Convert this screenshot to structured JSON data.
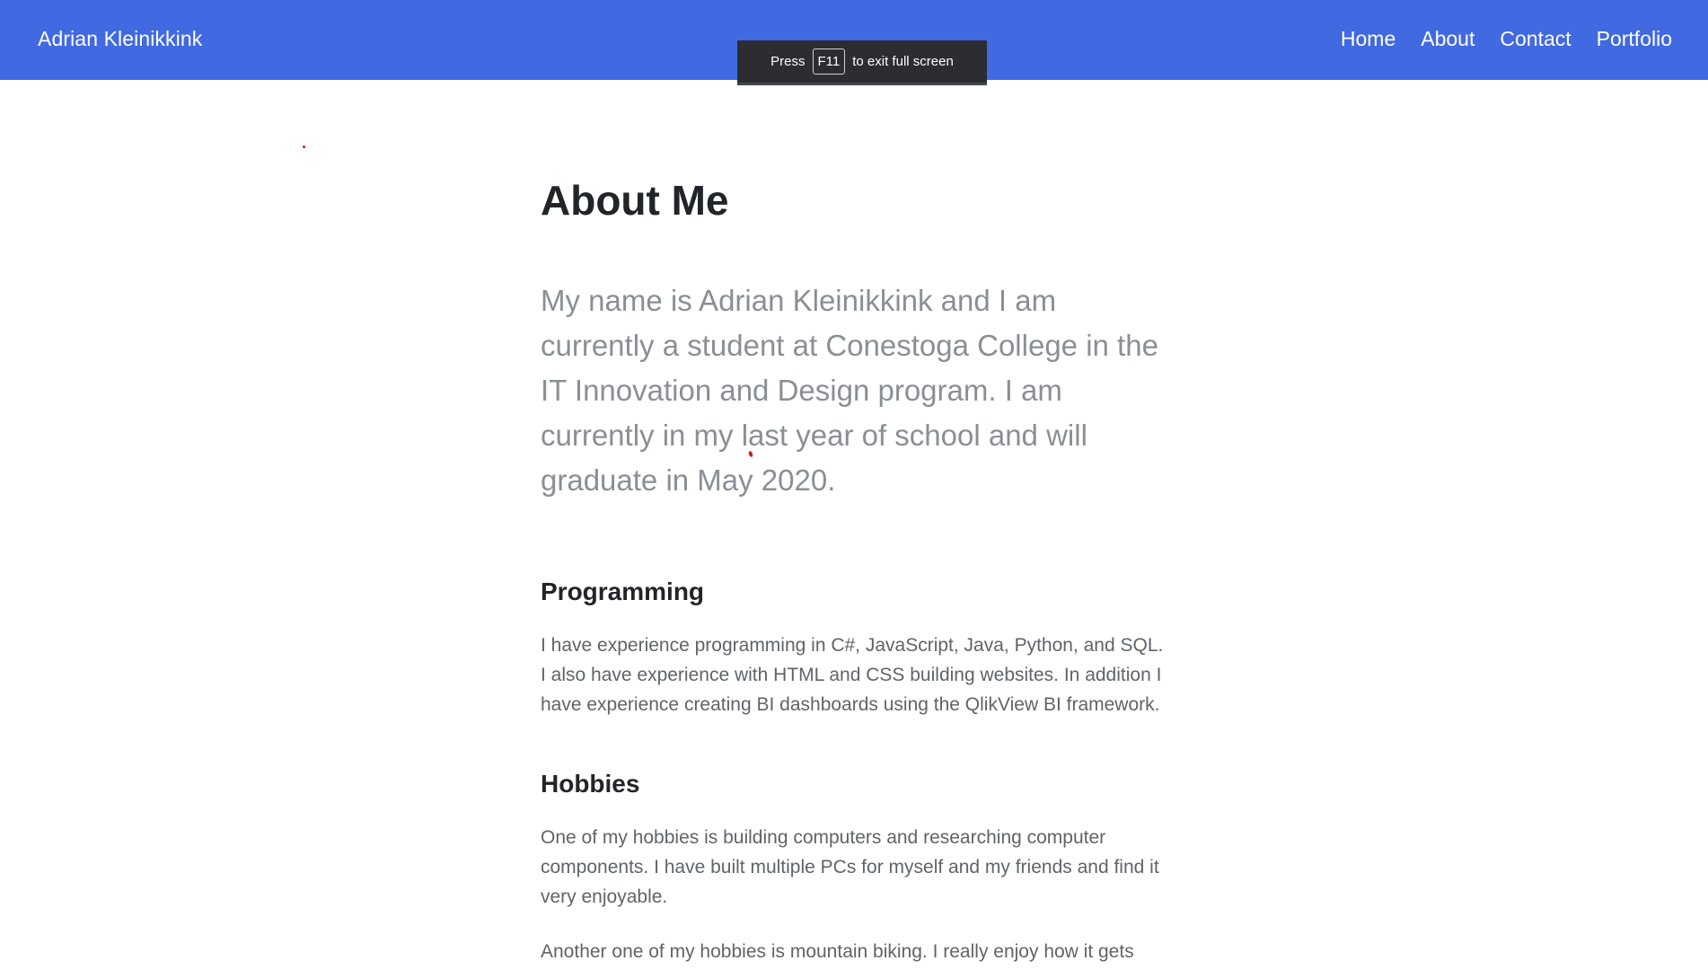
{
  "navbar": {
    "brand": "Adrian Kleinikkink",
    "links": [
      "Home",
      "About",
      "Contact",
      "Portfolio"
    ]
  },
  "fullscreen_toast": {
    "prefix": "Press",
    "key": "F11",
    "suffix": "to exit full screen"
  },
  "main": {
    "title": "About Me",
    "lead": "My name is Adrian Kleinikkink and I am currently a student at Conestoga College in the IT Innovation and Design program. I am currently in my last year of school and will graduate in May 2020.",
    "sections": [
      {
        "heading": "Programming",
        "paragraphs": [
          "I have experience programming in C#, JavaScript, Java, Python, and SQL. I also have experience with HTML and CSS building websites. In addition I have experience creating BI dashboards using the QlikView BI framework."
        ]
      },
      {
        "heading": "Hobbies",
        "paragraphs": [
          "One of my hobbies is building computers and researching computer components. I have built multiple PCs for myself and my friends and find it very enjoyable.",
          "Another one of my hobbies is mountain biking. I really enjoy how it gets"
        ]
      }
    ]
  },
  "colors": {
    "navbar": "#4169e1",
    "heading": "#212529",
    "lead": "#8a8f96",
    "body": "#5f6469",
    "toast": "#2b2d33"
  }
}
